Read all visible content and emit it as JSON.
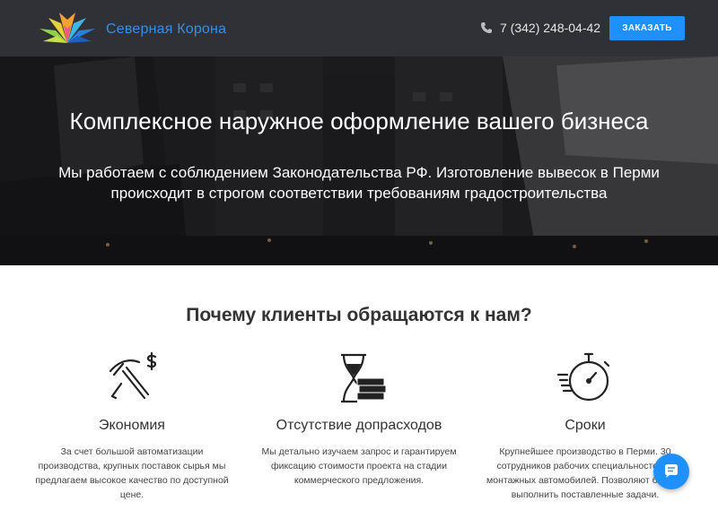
{
  "header": {
    "brand": "Северная Корона",
    "phone": "7 (342) 248-04-42",
    "cta_label": "ЗАКАЗАТЬ"
  },
  "hero": {
    "title": "Комплексное наружное оформление вашего бизнеса",
    "subtitle": "Мы работаем с соблюдением Законодательства РФ. Изготовление вывесок в Перми происходит в строгом соответствии требованиям градостроительства"
  },
  "why": {
    "title": "Почему клиенты обращаются к нам?",
    "features": [
      {
        "icon": "pickaxe-dollar-icon",
        "title": "Экономия",
        "text": "За счет большой автоматизации производства, крупных поставок сырья мы предлагаем высокое качество по доступной цене."
      },
      {
        "icon": "hourglass-money-icon",
        "title": "Отсутствие допрасходов",
        "text": "Мы детально изучаем запрос и гарантируем фиксацию стоимости проекта на стадии коммерческого предложения."
      },
      {
        "icon": "stopwatch-icon",
        "title": "Сроки",
        "text": "Крупнейшее производство в Перми. 30 сотрудников рабочих специальностей, 8 монтажных автомобилей. Позволяют быстро выполнить поставленные задачи."
      }
    ]
  },
  "colors": {
    "header_bg": "#2f3136",
    "accent": "#1e90ff",
    "brand_text": "#3a8ee6"
  }
}
